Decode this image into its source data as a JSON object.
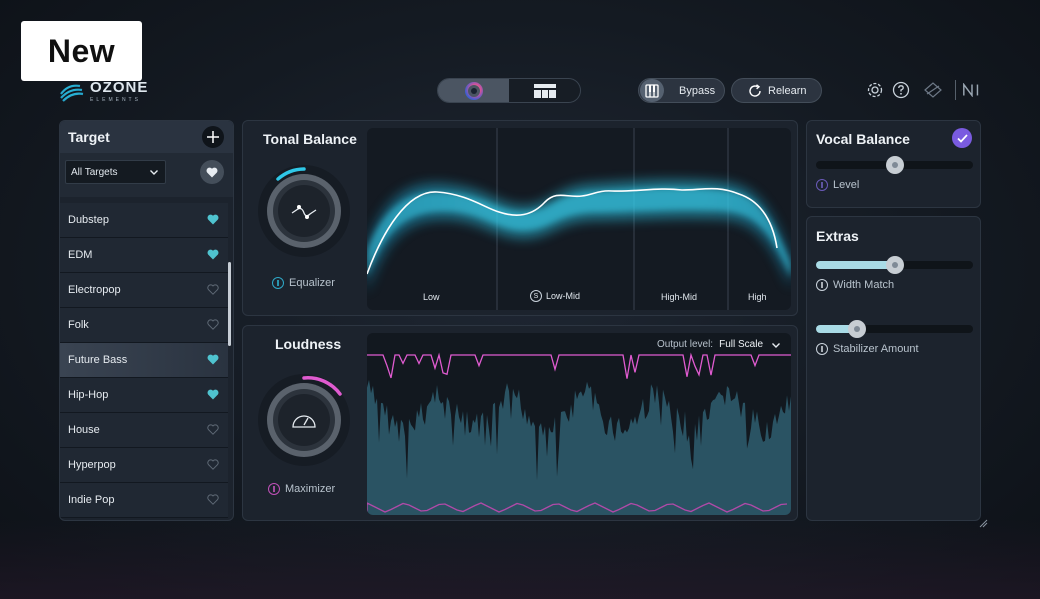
{
  "badge": "New",
  "logo": {
    "name": "OZONE",
    "sub": "ELEMENTS"
  },
  "toolbar": {
    "bypass_label": "Bypass",
    "relearn_label": "Relearn"
  },
  "target": {
    "title": "Target",
    "filter_value": "All Targets",
    "items": [
      {
        "label": "Dubstep",
        "favorite": true
      },
      {
        "label": "EDM",
        "favorite": true
      },
      {
        "label": "Electropop",
        "favorite": false
      },
      {
        "label": "Folk",
        "favorite": false
      },
      {
        "label": "Future Bass",
        "favorite": true,
        "selected": true
      },
      {
        "label": "Hip-Hop",
        "favorite": true
      },
      {
        "label": "House",
        "favorite": false
      },
      {
        "label": "Hyperpop",
        "favorite": false
      },
      {
        "label": "Indie Pop",
        "favorite": false
      }
    ]
  },
  "tonal": {
    "title": "Tonal Balance",
    "knob_label": "Equalizer",
    "bands": [
      "Low",
      "Low-Mid",
      "High-Mid",
      "High"
    ]
  },
  "loudness": {
    "title": "Loudness",
    "knob_label": "Maximizer",
    "output_label": "Output level:",
    "output_value": "Full Scale"
  },
  "vocal": {
    "title": "Vocal Balance",
    "level_label": "Level",
    "level_value": 0.5
  },
  "extras": {
    "title": "Extras",
    "width_label": "Width Match",
    "width_value": 0.5,
    "stabilizer_label": "Stabilizer Amount",
    "stabilizer_value": 0.26
  },
  "colors": {
    "accent_cyan": "#2fc8e8",
    "accent_pink": "#e05bd0",
    "accent_purple": "#7a5be0",
    "heart_fav": "#4fc3cf"
  }
}
